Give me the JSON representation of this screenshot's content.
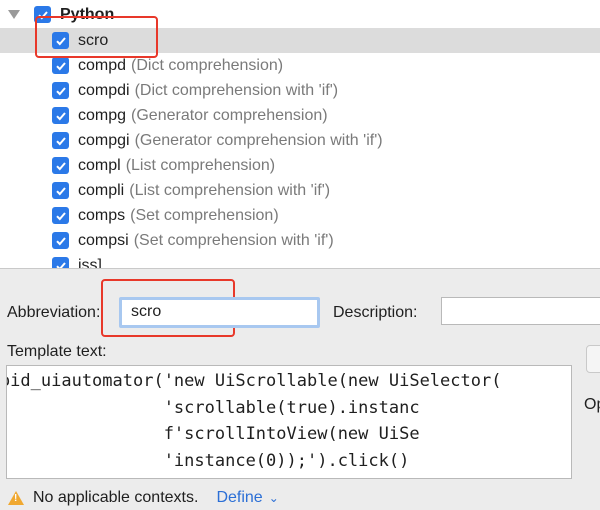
{
  "tree": {
    "group": {
      "label": "Python",
      "checked": true
    },
    "items": [
      {
        "abbr": "scro",
        "desc": "",
        "checked": true,
        "selected": true
      },
      {
        "abbr": "compd",
        "desc": "(Dict comprehension)",
        "checked": true
      },
      {
        "abbr": "compdi",
        "desc": "(Dict comprehension with 'if')",
        "checked": true
      },
      {
        "abbr": "compg",
        "desc": "(Generator comprehension)",
        "checked": true
      },
      {
        "abbr": "compgi",
        "desc": "(Generator comprehension with 'if')",
        "checked": true
      },
      {
        "abbr": "compl",
        "desc": "(List comprehension)",
        "checked": true
      },
      {
        "abbr": "compli",
        "desc": "(List comprehension with 'if')",
        "checked": true
      },
      {
        "abbr": "comps",
        "desc": "(Set comprehension)",
        "checked": true
      },
      {
        "abbr": "compsi",
        "desc": "(Set comprehension with 'if')",
        "checked": true
      },
      {
        "abbr": "iss]",
        "desc": "",
        "checked": true
      }
    ]
  },
  "form": {
    "abbreviation_label": "Abbreviation:",
    "abbreviation_value": "scro",
    "description_label": "Description:",
    "description_value": "",
    "template_label": "Template text:",
    "template_lines": [
      "android_uiautomator('new UiScrollable(new UiSelector(",
      "                    'scrollable(true).instanc",
      "                    f'scrollIntoView(new UiSe",
      "                    'instance(0));').click()"
    ],
    "side_label": "Op"
  },
  "footer": {
    "warning_text": "No applicable contexts.",
    "define_label": "Define",
    "define_chevron": "⌄"
  },
  "colors": {
    "accent": "#2b79e8",
    "annotation": "#e8382a",
    "link": "#2b6fd6",
    "warning": "#f0a830"
  }
}
